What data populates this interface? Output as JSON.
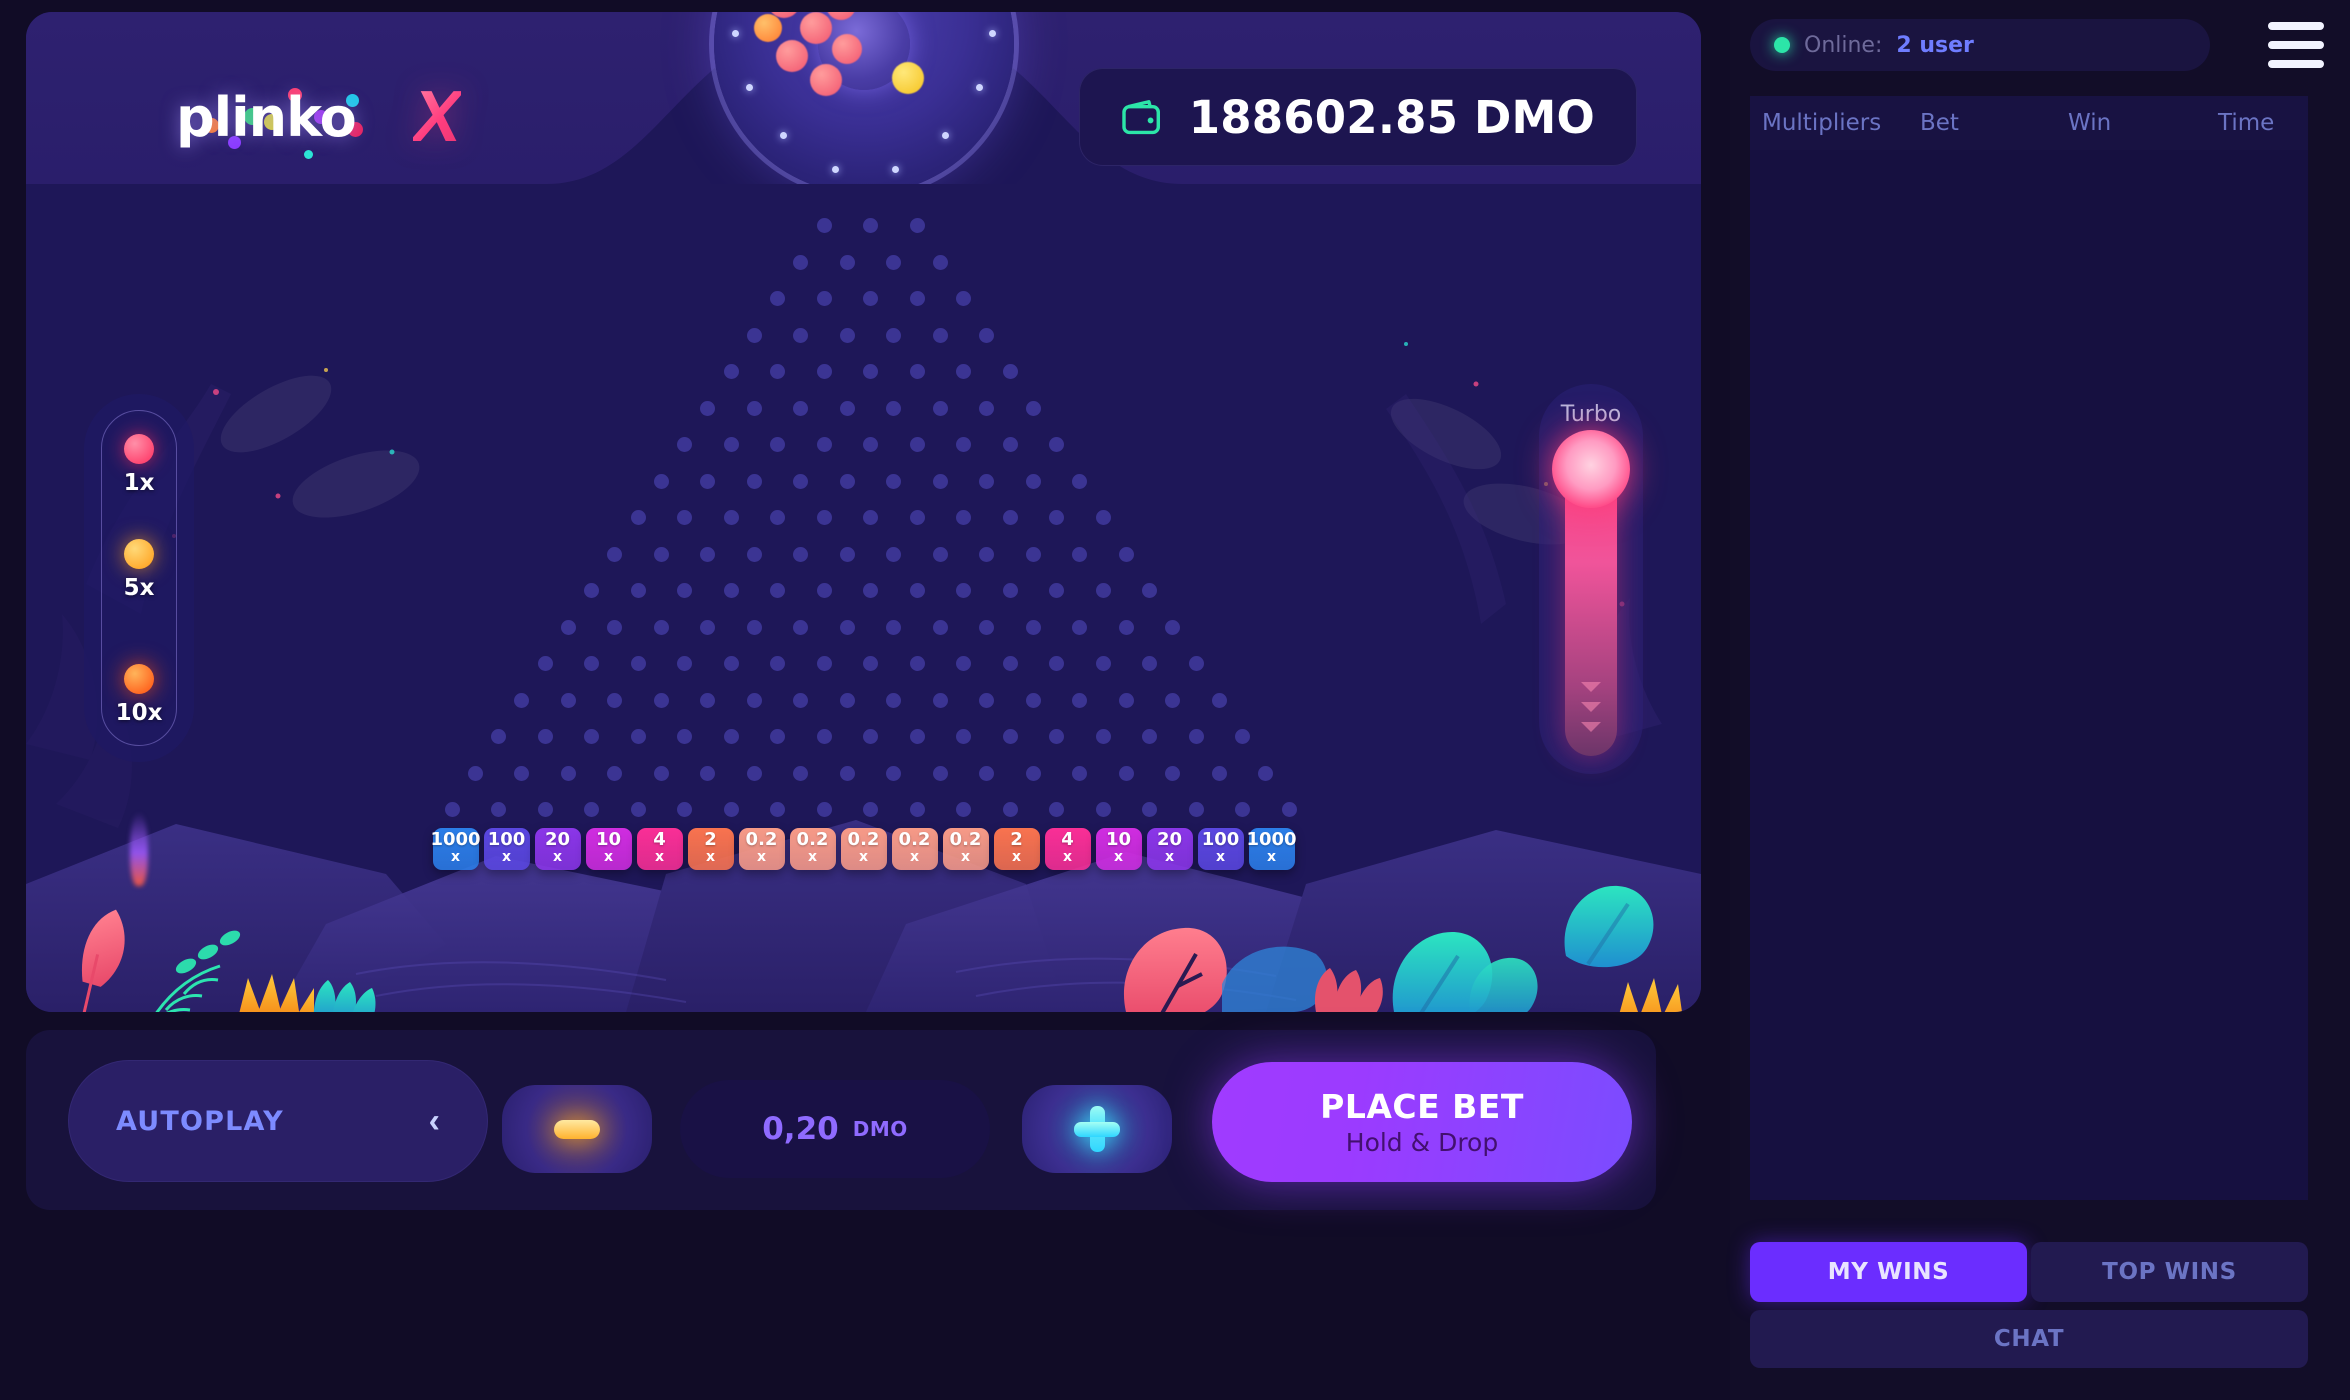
{
  "brand": {
    "name": "plinko",
    "x_mark": "X"
  },
  "header": {
    "balance_amount": "188602.85 DMO",
    "wallet_icon": "wallet-icon"
  },
  "left_rail": {
    "items": [
      {
        "label": "1x",
        "color": "#ff3d6e"
      },
      {
        "label": "5x",
        "color": "#ffad2b"
      },
      {
        "label": "10x",
        "color": "#ff6a1e"
      }
    ]
  },
  "turbo": {
    "label": "Turbo",
    "track_color": "#ff3a7a",
    "chevron_icon": "chevron-down-icon"
  },
  "slots": [
    {
      "value": "1000",
      "suffix": "x",
      "color": "#2b7ee8"
    },
    {
      "value": "100",
      "suffix": "x",
      "color": "#5a47e0"
    },
    {
      "value": "20",
      "suffix": "x",
      "color": "#8b36e8"
    },
    {
      "value": "10",
      "suffix": "x",
      "color": "#d02de0"
    },
    {
      "value": "4",
      "suffix": "x",
      "color": "#fa2f96"
    },
    {
      "value": "2",
      "suffix": "x",
      "color": "#f9734f"
    },
    {
      "value": "0.2",
      "suffix": "x",
      "color": "#f79a87"
    },
    {
      "value": "0.2",
      "suffix": "x",
      "color": "#f79a87"
    },
    {
      "value": "0.2",
      "suffix": "x",
      "color": "#f79a87"
    },
    {
      "value": "0.2",
      "suffix": "x",
      "color": "#f79a87"
    },
    {
      "value": "0.2",
      "suffix": "x",
      "color": "#f79a87"
    },
    {
      "value": "2",
      "suffix": "x",
      "color": "#f9734f"
    },
    {
      "value": "4",
      "suffix": "x",
      "color": "#fa2f96"
    },
    {
      "value": "10",
      "suffix": "x",
      "color": "#d02de0"
    },
    {
      "value": "20",
      "suffix": "x",
      "color": "#8b36e8"
    },
    {
      "value": "100",
      "suffix": "x",
      "color": "#5a47e0"
    },
    {
      "value": "1000",
      "suffix": "x",
      "color": "#2b7ee8"
    }
  ],
  "controls": {
    "autoplay_label": "AUTOPLAY",
    "autoplay_chevron": "‹",
    "decrease_icon": "minus-icon",
    "increase_icon": "plus-icon",
    "bet_value": "0,20",
    "bet_currency": "DMO",
    "place_bet_title": "PLACE BET",
    "place_bet_subtitle": "Hold & Drop"
  },
  "side_panel": {
    "online_label": "Online:",
    "online_count": "2 user",
    "menu_icon": "hamburger-menu-icon",
    "columns": [
      "Multipliers",
      "Bet",
      "Win",
      "Time"
    ],
    "rows": [],
    "tabs": [
      {
        "label": "MY WINS",
        "active": true
      },
      {
        "label": "TOP WINS",
        "active": false
      }
    ],
    "chat_label": "CHAT"
  }
}
